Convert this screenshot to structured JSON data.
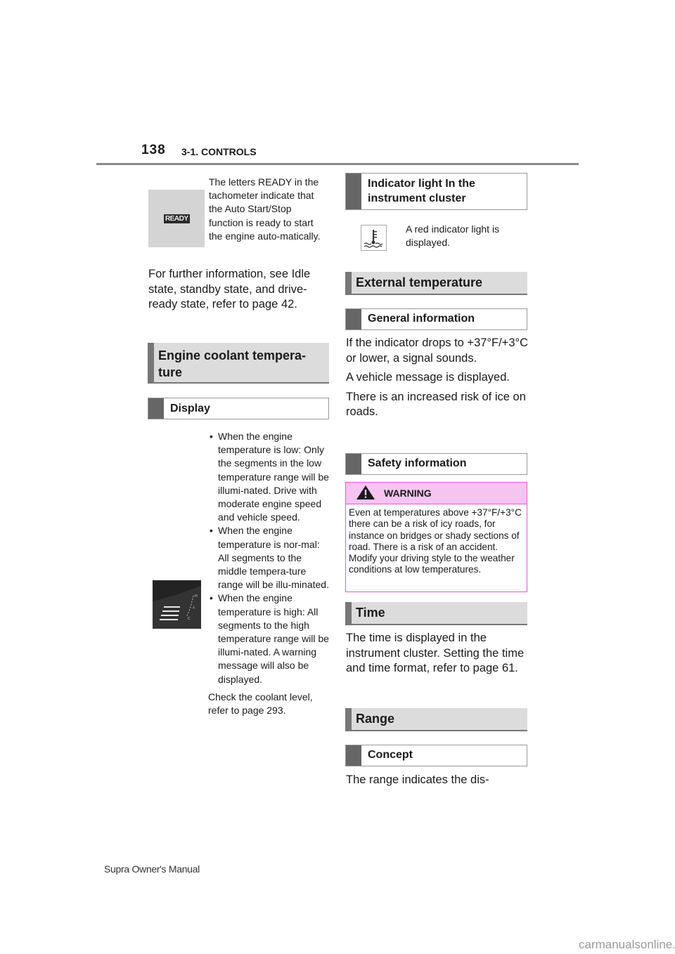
{
  "header": {
    "page_number": "138",
    "section": "3-1. CONTROLS"
  },
  "left_column": {
    "ready_image": {
      "icon": "ready-indicator-image",
      "badge_text": "READY"
    },
    "ready_text": "The letters READY in the tachometer indicate that the Auto Start/Stop function is ready to start the engine auto-matically.",
    "further_info": "For further information, see Idle state, standby state, and drive-ready state, refer to page 42.",
    "heading_coolant": "Engine coolant tempera-ture",
    "subheading_display": "Display",
    "coolant_image": {
      "icon": "coolant-temperature-gauge-image"
    },
    "bullets": [
      "When the engine temperature is low: Only the segments in the low temperature range will be illumi-nated. Drive with moderate engine speed and vehicle speed.",
      "When the engine temperature is nor-mal: All segments to the middle tempera-ture range will be illu-minated.",
      "When the engine temperature is high: All segments to the high temperature range will be illumi-nated. A warning message will also be displayed."
    ],
    "check_coolant": "Check the coolant level, refer to page 293."
  },
  "right_column": {
    "heading_indicator": "Indicator light In the instrument cluster",
    "indicator_icon": "coolant-temperature-warning-icon",
    "indicator_text": "A red indicator light is displayed.",
    "heading_external": "External temperature",
    "subheading_general": "General information",
    "general_p1": "If the indicator drops to +37°F/+3°C or lower, a signal sounds.",
    "general_p2": "A vehicle message is displayed.",
    "general_p3": "There is an increased risk of ice on roads.",
    "subheading_safety": "Safety information",
    "warning": {
      "icon": "warning-triangle-icon",
      "title": "WARNING",
      "body": "Even at temperatures above +37°F/+3°C there can be a risk of icy roads, for instance on bridges or shady sections of road. There is a risk of an accident. Modify your driving style to the weather conditions at low temperatures.",
      "border_color": "#e855d8",
      "header_bg": "#f6c4f1"
    },
    "heading_time": "Time",
    "time_text": "The time is displayed in the instrument cluster. Setting the time and time format, refer to page 61.",
    "heading_range": "Range",
    "subheading_concept": "Concept",
    "range_text": "The range indicates the dis-"
  },
  "footer": {
    "manual_title": "Supra Owner's Manual",
    "watermark": "carmanualsonline.info"
  }
}
